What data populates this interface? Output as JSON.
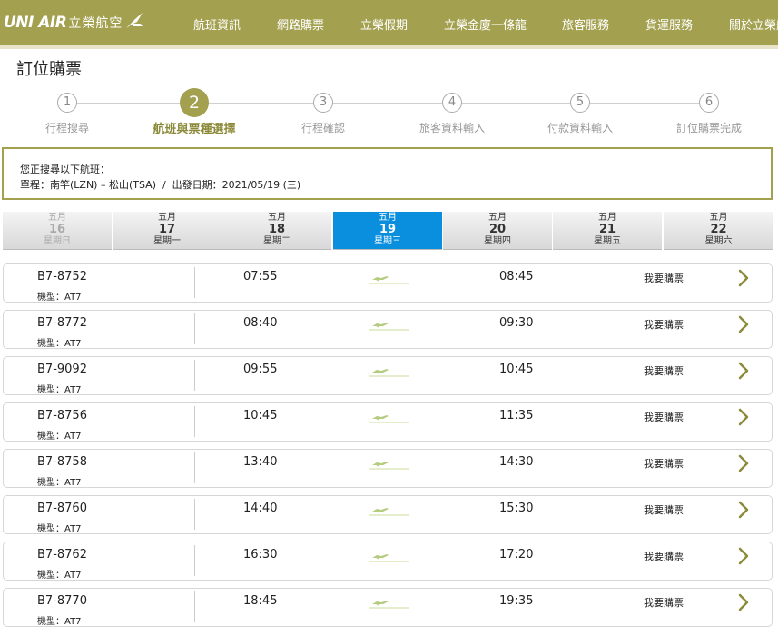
{
  "header": {
    "logo_text": "UNI AIR",
    "logo_cn": "立榮航空",
    "nav": [
      "航班資訊",
      "網路購票",
      "立榮假期",
      "立榮金廈一條龍",
      "旅客服務",
      "貨運服務",
      "關於立榮航空"
    ]
  },
  "page": {
    "title": "訂位購票"
  },
  "steps": [
    {
      "num": "1",
      "label": "行程搜尋",
      "active": false
    },
    {
      "num": "2",
      "label": "航班與票種選擇",
      "active": true
    },
    {
      "num": "3",
      "label": "行程確認",
      "active": false
    },
    {
      "num": "4",
      "label": "旅客資料輸入",
      "active": false
    },
    {
      "num": "5",
      "label": "付款資料輸入",
      "active": false
    },
    {
      "num": "6",
      "label": "訂位購票完成",
      "active": false
    }
  ],
  "search": {
    "heading": "您正搜尋以下航班：",
    "detail": "單程：南竿(LZN) – 松山(TSA)  /  出發日期：2021/05/19 (三)"
  },
  "dates": [
    {
      "month": "五月",
      "day": "16",
      "weekday": "星期日",
      "state": "disabled"
    },
    {
      "month": "五月",
      "day": "17",
      "weekday": "星期一",
      "state": "normal"
    },
    {
      "month": "五月",
      "day": "18",
      "weekday": "星期二",
      "state": "normal"
    },
    {
      "month": "五月",
      "day": "19",
      "weekday": "星期三",
      "state": "active"
    },
    {
      "month": "五月",
      "day": "20",
      "weekday": "星期四",
      "state": "normal"
    },
    {
      "month": "五月",
      "day": "21",
      "weekday": "星期五",
      "state": "normal"
    },
    {
      "month": "五月",
      "day": "22",
      "weekday": "星期六",
      "state": "normal"
    }
  ],
  "flights": [
    {
      "no": "B7-8752",
      "type": "機型：AT7",
      "dep": "07:55",
      "arr": "08:45",
      "buy": "我要購票"
    },
    {
      "no": "B7-8772",
      "type": "機型：AT7",
      "dep": "08:40",
      "arr": "09:30",
      "buy": "我要購票"
    },
    {
      "no": "B7-9092",
      "type": "機型：AT7",
      "dep": "09:55",
      "arr": "10:45",
      "buy": "我要購票"
    },
    {
      "no": "B7-8756",
      "type": "機型：AT7",
      "dep": "10:45",
      "arr": "11:35",
      "buy": "我要購票"
    },
    {
      "no": "B7-8758",
      "type": "機型：AT7",
      "dep": "13:40",
      "arr": "14:30",
      "buy": "我要購票"
    },
    {
      "no": "B7-8760",
      "type": "機型：AT7",
      "dep": "14:40",
      "arr": "15:30",
      "buy": "我要購票"
    },
    {
      "no": "B7-8762",
      "type": "機型：AT7",
      "dep": "16:30",
      "arr": "17:20",
      "buy": "我要購票"
    },
    {
      "no": "B7-8770",
      "type": "機型：AT7",
      "dep": "18:45",
      "arr": "19:35",
      "buy": "我要購票"
    }
  ],
  "icons": {
    "plane": "plane-icon",
    "chevron": "chevron-right-icon",
    "logo_mark": "uni-air-bird-icon"
  },
  "colors": {
    "brand": "#a3a04f",
    "active_date": "#0a8fde",
    "chevron": "#8c8a3a"
  }
}
